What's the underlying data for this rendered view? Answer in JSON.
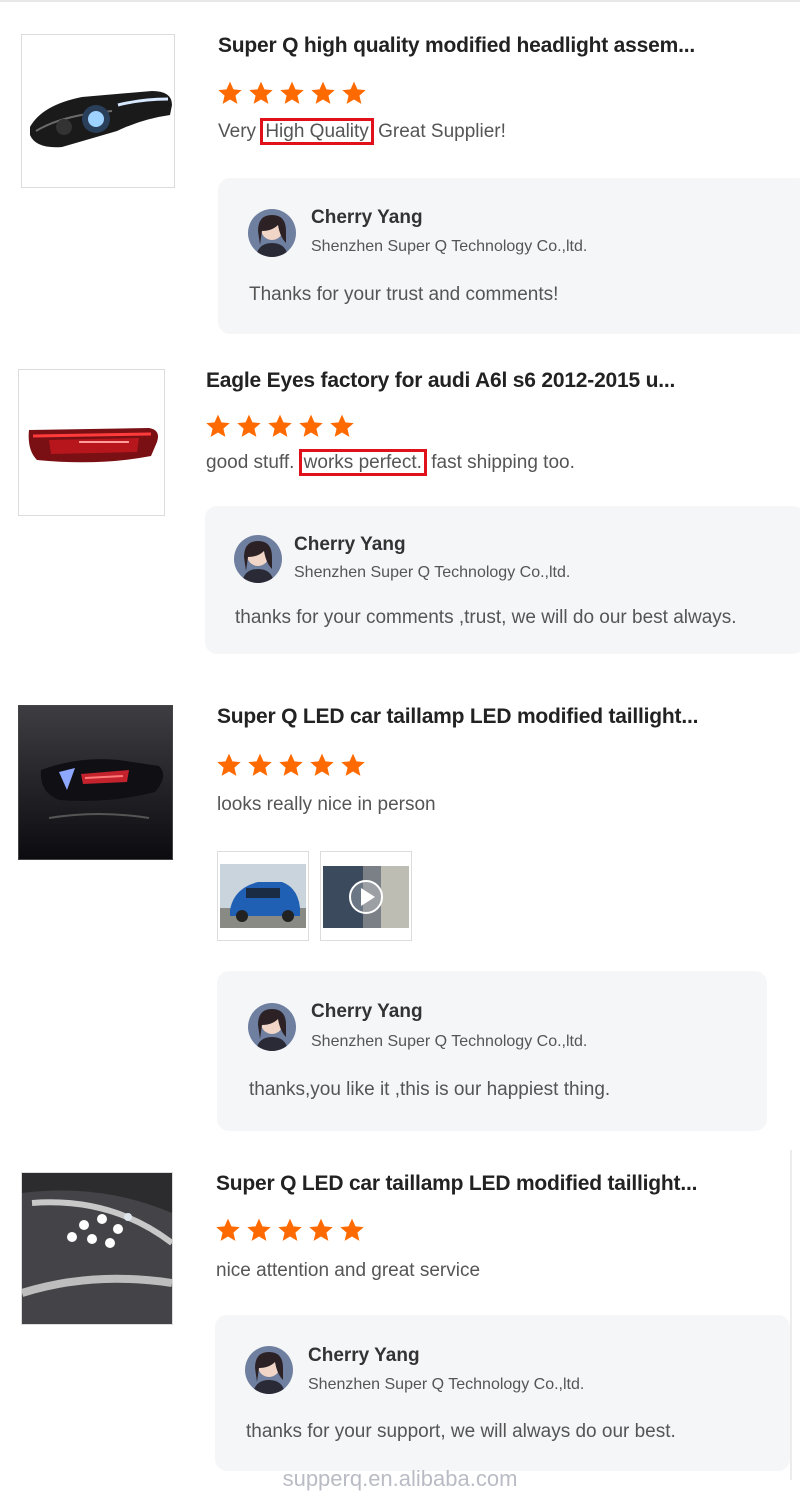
{
  "reviews": [
    {
      "product_image": "headlight-image",
      "title": "Super Q high quality modified headlight assem...",
      "rating": 5,
      "comment": {
        "before": "Very",
        "highlight": "High Quality",
        "after": "Great Supplier!"
      },
      "reply": {
        "name": "Cherry Yang",
        "company": "Shenzhen Super Q Technology Co.,ltd.",
        "text": "Thanks for your trust and comments!"
      }
    },
    {
      "product_image": "taillight-red-image",
      "title": "Eagle Eyes factory for audi A6l s6 2012-2015 u...",
      "rating": 5,
      "comment": {
        "before": "good stuff.",
        "highlight": "works perfect.",
        "after": "fast shipping too."
      },
      "reply": {
        "name": "Cherry Yang",
        "company": "Shenzhen Super Q Technology Co.,ltd.",
        "text": "thanks for your comments ,trust, we will do our best always."
      }
    },
    {
      "product_image": "taillamp-dark-image",
      "title": "Super Q LED car taillamp LED modified taillight...",
      "rating": 5,
      "comment": {
        "before": "looks really nice in person",
        "highlight": "",
        "after": ""
      },
      "attachments": [
        "car-photo-thumbnail",
        "video-thumbnail"
      ],
      "reply": {
        "name": "Cherry Yang",
        "company": "Shenzhen Super Q Technology Co.,ltd.",
        "text": "thanks,you like it ,this is our happiest thing."
      }
    },
    {
      "product_image": "led-lamp-closeup-image",
      "title": "Super Q LED car taillamp LED modified taillight...",
      "rating": 5,
      "comment": {
        "before": "nice attention and great service",
        "highlight": "",
        "after": ""
      },
      "reply": {
        "name": "Cherry Yang",
        "company": "Shenzhen Super Q Technology Co.,ltd.",
        "text": "thanks for your support, we will always do our best."
      }
    }
  ],
  "watermark": "supperq.en.alibaba.com",
  "colors": {
    "star": "#ff6a00",
    "highlight_box": "#e0111a",
    "reply_bg": "#f5f6f8"
  }
}
